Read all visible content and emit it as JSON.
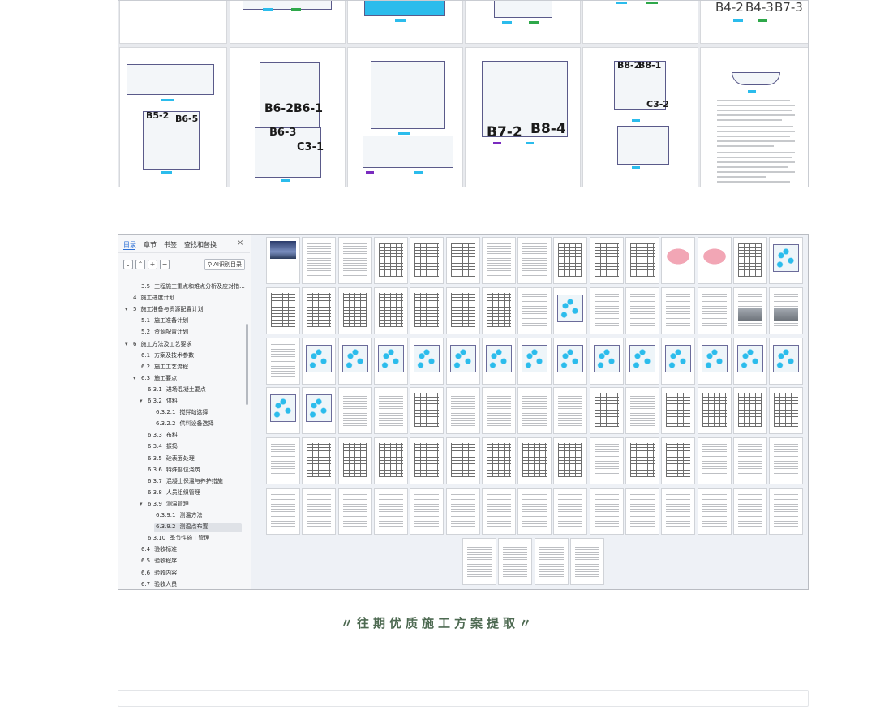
{
  "top_preview": {
    "plan_labels": {
      "row1": [
        "B4-2",
        "B4-3",
        "B7-3"
      ],
      "p1": [
        "B5-2",
        "B6-5"
      ],
      "p2": [
        "B6-2",
        "B6-1",
        "B6-3",
        "C3-1"
      ],
      "p4": [
        "B7-2",
        "B8-4"
      ],
      "p5": [
        "B8-2",
        "B8-1",
        "C3-2"
      ]
    }
  },
  "doc_window": {
    "sidebar": {
      "tabs": [
        "目录",
        "章节",
        "书签",
        "查找和替换"
      ],
      "close_glyph": "×",
      "toolbar": {
        "collapse": "⌄",
        "expand": "⌃",
        "add": "+",
        "remove": "−",
        "ai_button": "AI识别目录"
      },
      "toc": [
        {
          "num": "3.5",
          "label": "工程施工重点和难点分析及应对措..."
        },
        {
          "num": "4",
          "label": "施工进度计划"
        },
        {
          "num": "5",
          "label": "施工准备与资源配置计划",
          "arrow": "▾"
        },
        {
          "num": "5.1",
          "label": "施工准备计划"
        },
        {
          "num": "5.2",
          "label": "资源配置计划"
        },
        {
          "num": "6",
          "label": "施工方法及工艺要求",
          "arrow": "▾"
        },
        {
          "num": "6.1",
          "label": "方案及技术参数"
        },
        {
          "num": "6.2",
          "label": "施工工艺流程"
        },
        {
          "num": "6.3",
          "label": "施工要点",
          "arrow": "▾"
        },
        {
          "num": "6.3.1",
          "label": "进场混凝土要点"
        },
        {
          "num": "6.3.2",
          "label": "供料",
          "arrow": "▾"
        },
        {
          "num": "6.3.2.1",
          "label": "搅拌站选择"
        },
        {
          "num": "6.3.2.2",
          "label": "供料设备选择"
        },
        {
          "num": "6.3.3",
          "label": "布料"
        },
        {
          "num": "6.3.4",
          "label": "振捣"
        },
        {
          "num": "6.3.5",
          "label": "砼表面处理"
        },
        {
          "num": "6.3.6",
          "label": "特殊部位浇筑"
        },
        {
          "num": "6.3.7",
          "label": "混凝土保温与养护措施"
        },
        {
          "num": "6.3.8",
          "label": "人员组织管理"
        },
        {
          "num": "6.3.9",
          "label": "测温管理",
          "arrow": "▾"
        },
        {
          "num": "6.3.9.1",
          "label": "测温方法"
        },
        {
          "num": "6.3.9.2",
          "label": "测温点布置",
          "selected": true
        },
        {
          "num": "6.3.10",
          "label": "季节性施工管理"
        },
        {
          "num": "6.4",
          "label": "验收标准"
        },
        {
          "num": "6.5",
          "label": "验收程序"
        },
        {
          "num": "6.6",
          "label": "验收内容"
        },
        {
          "num": "6.7",
          "label": "验收人员"
        }
      ]
    }
  },
  "banner": {
    "text": "〃往期优质施工方案提取〃"
  },
  "colors": {
    "banner": "#4e6a52",
    "accent_blue": "#2bbcec",
    "selected_tab": "#2b6fd6"
  }
}
